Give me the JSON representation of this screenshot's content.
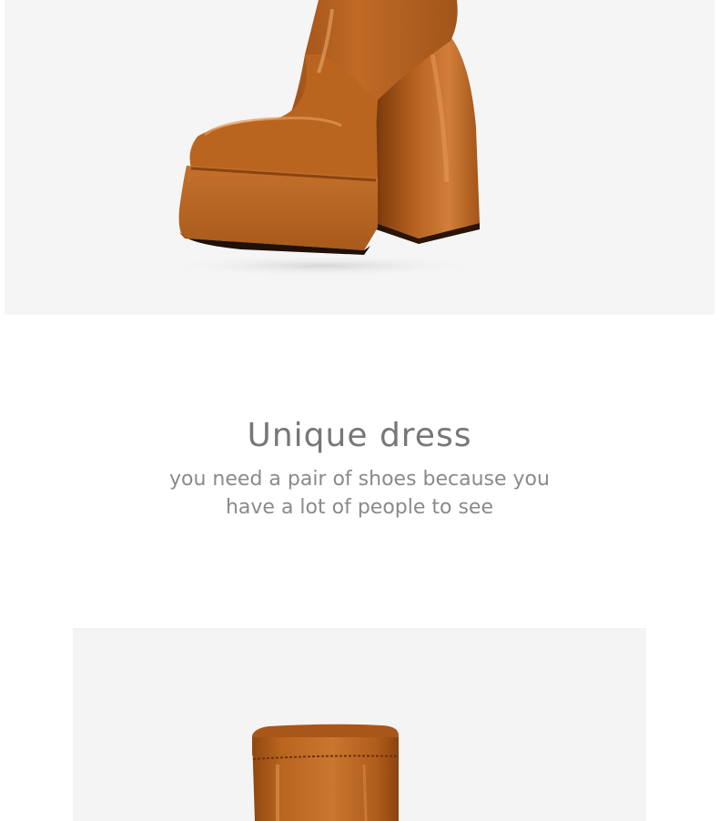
{
  "product_images": [
    {
      "subject": "boot-platform-side",
      "color": "#b4621e"
    },
    {
      "subject": "boot-shaft-top",
      "color": "#b4621e"
    }
  ],
  "feature": {
    "headline": "Unique dress",
    "tagline": "you need a pair of shoes because you have a lot of people to see"
  },
  "colors": {
    "leather": "#b4621e",
    "leather_dark": "#7a3a0c",
    "leather_highlight": "#e39a5a",
    "background": "#f5f5f5",
    "text": "#777777"
  }
}
